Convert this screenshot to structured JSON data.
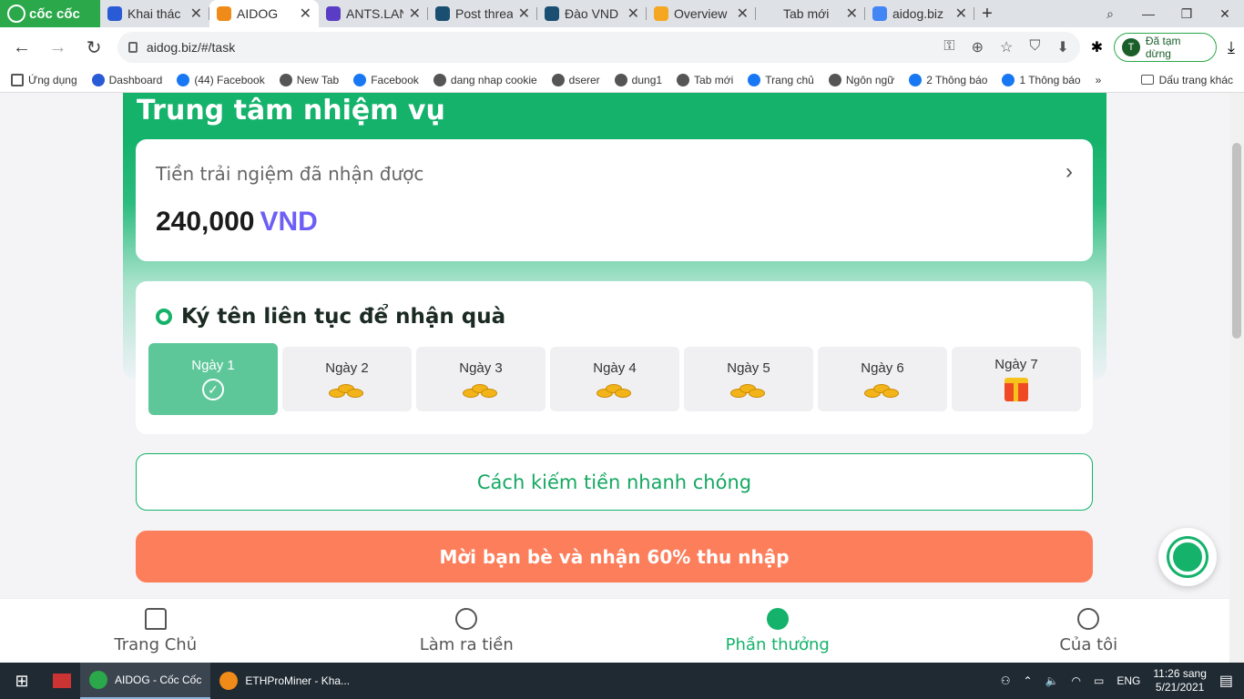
{
  "browser": {
    "brand": "cốc cốc",
    "tabs": [
      {
        "label": "Khai thác",
        "color": "#2a5bd7"
      },
      {
        "label": "AIDOG",
        "color": "#f08a18",
        "active": true
      },
      {
        "label": "ANTS.LAN",
        "color": "#5b3cc4"
      },
      {
        "label": "Post threa",
        "color": "#1b4f72"
      },
      {
        "label": "Đào VND",
        "color": "#1b4f72"
      },
      {
        "label": "Overview",
        "color": "#f5a623"
      },
      {
        "label": "Tab mới",
        "color": "#dee1e6"
      },
      {
        "label": "aidog.biz",
        "color": "#4285f4"
      }
    ],
    "url": "aidog.biz/#/task",
    "profile_initial": "T",
    "profile_status": "Đã tạm dừng",
    "bookmarks": [
      {
        "label": "Ứng dụng",
        "icon": "grid"
      },
      {
        "label": "Dashboard",
        "icon": "s"
      },
      {
        "label": "(44) Facebook",
        "icon": "fb"
      },
      {
        "label": "New Tab",
        "icon": "g"
      },
      {
        "label": "Facebook",
        "icon": "fb"
      },
      {
        "label": "dang nhap cookie",
        "icon": "g"
      },
      {
        "label": "dserer",
        "icon": "g"
      },
      {
        "label": "dung1",
        "icon": "g"
      },
      {
        "label": "Tab mới",
        "icon": "g"
      },
      {
        "label": "Trang chủ",
        "icon": "fb"
      },
      {
        "label": "Ngôn ngữ",
        "icon": "g"
      },
      {
        "label": "2 Thông báo",
        "icon": "fb"
      },
      {
        "label": "1 Thông báo",
        "icon": "fb"
      }
    ],
    "bookmarks_more": "»",
    "other_bookmarks": "Dấu trang khác"
  },
  "page": {
    "title": "Trung tâm nhiệm vụ",
    "balance": {
      "label": "Tiền trải ngiệm đã nhận được",
      "amount": "240,000",
      "currency": "VND"
    },
    "checkin": {
      "title": "Ký tên liên tục để nhận quà",
      "days": [
        {
          "label": "Ngày 1",
          "state": "done"
        },
        {
          "label": "Ngày 2",
          "state": "coins"
        },
        {
          "label": "Ngày 3",
          "state": "coins"
        },
        {
          "label": "Ngày 4",
          "state": "coins"
        },
        {
          "label": "Ngày 5",
          "state": "coins"
        },
        {
          "label": "Ngày 6",
          "state": "coins"
        },
        {
          "label": "Ngày 7",
          "state": "gift"
        }
      ]
    },
    "guide_button": "Cách kiếm tiền nhanh chóng",
    "invite_button": "Mời bạn bè và nhận 60% thu nhập"
  },
  "bottom_nav": [
    {
      "label": "Trang Chủ",
      "icon": "home-icon"
    },
    {
      "label": "Làm ra tiền",
      "icon": "dollar-icon"
    },
    {
      "label": "Phần thưởng",
      "icon": "group-icon",
      "active": true
    },
    {
      "label": "Của tôi",
      "icon": "smile-icon"
    }
  ],
  "taskbar": {
    "apps": [
      {
        "label": "AIDOG - Cốc Cốc",
        "active": true
      },
      {
        "label": "ETHProMiner - Kha..."
      }
    ],
    "lang": "ENG",
    "time": "11:26 sang",
    "date": "5/21/2021"
  }
}
